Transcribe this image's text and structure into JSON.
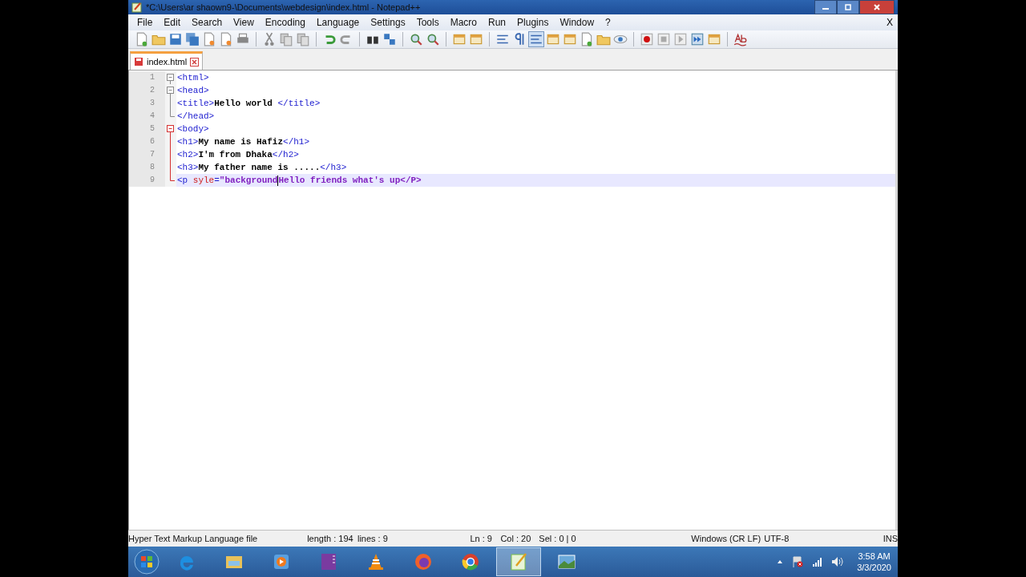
{
  "window": {
    "title": "*C:\\Users\\ar shaown9-\\Documents\\webdesign\\index.html - Notepad++"
  },
  "menu": [
    "File",
    "Edit",
    "Search",
    "View",
    "Encoding",
    "Language",
    "Settings",
    "Tools",
    "Macro",
    "Run",
    "Plugins",
    "Window",
    "?"
  ],
  "menu_close": "X",
  "tabs": [
    {
      "label": "index.html",
      "selected": true,
      "modified": true
    }
  ],
  "editor": {
    "lines": [
      {
        "number": "1",
        "fold": {
          "kind": "minus",
          "active": false
        },
        "current": false,
        "tokens": [
          {
            "kind": "tag",
            "text": "<html>"
          }
        ]
      },
      {
        "number": "2",
        "fold": {
          "kind": "minus",
          "active": false
        },
        "current": false,
        "tokens": [
          {
            "kind": "tag",
            "text": "<head>"
          }
        ]
      },
      {
        "number": "3",
        "fold": {
          "kind": "bar",
          "active": false
        },
        "current": false,
        "tokens": [
          {
            "kind": "tag",
            "text": "<title>"
          },
          {
            "kind": "text",
            "text": "Hello world "
          },
          {
            "kind": "tag",
            "text": "</title>"
          }
        ]
      },
      {
        "number": "4",
        "fold": {
          "kind": "corner",
          "active": false
        },
        "current": false,
        "tokens": [
          {
            "kind": "tag",
            "text": "</head>"
          }
        ]
      },
      {
        "number": "5",
        "fold": {
          "kind": "minus",
          "active": true
        },
        "current": false,
        "tokens": [
          {
            "kind": "tag",
            "text": "<body>"
          }
        ]
      },
      {
        "number": "6",
        "fold": {
          "kind": "bar",
          "active": true
        },
        "current": false,
        "tokens": [
          {
            "kind": "tag",
            "text": "<h1>"
          },
          {
            "kind": "text",
            "text": "My name is Hafiz"
          },
          {
            "kind": "tag",
            "text": "</h1>"
          }
        ]
      },
      {
        "number": "7",
        "fold": {
          "kind": "bar",
          "active": true
        },
        "current": false,
        "tokens": [
          {
            "kind": "tag",
            "text": "<h2>"
          },
          {
            "kind": "text",
            "text": "I'm from Dhaka"
          },
          {
            "kind": "tag",
            "text": "</h2>"
          }
        ]
      },
      {
        "number": "8",
        "fold": {
          "kind": "bar",
          "active": true
        },
        "current": false,
        "tokens": [
          {
            "kind": "tag",
            "text": "<h3>"
          },
          {
            "kind": "text",
            "text": "My father name is ....."
          },
          {
            "kind": "tag",
            "text": "</h3>"
          }
        ]
      },
      {
        "number": "9",
        "fold": {
          "kind": "corner",
          "active": true
        },
        "current": true,
        "tokens": [
          {
            "kind": "tag",
            "text": "<p"
          },
          {
            "kind": "attr",
            "text": " syle"
          },
          {
            "kind": "tag",
            "text": "="
          },
          {
            "kind": "string",
            "text": "\"background"
          },
          {
            "kind": "string",
            "text": "Hello friends what's up</P>",
            "caret": true
          }
        ]
      }
    ]
  },
  "status_bar": {
    "file_type": "Hyper Text Markup Language file",
    "length": "length : 194",
    "lines": "lines : 9",
    "position": "Ln : 9",
    "column": "Col : 20",
    "selection": "Sel : 0 | 0",
    "eol": "Windows (CR LF)",
    "encoding": "UTF-8",
    "mode": "INS"
  },
  "taskbar": {
    "apps": [
      {
        "kind": "ie",
        "active": false
      },
      {
        "kind": "explorer",
        "active": false
      },
      {
        "kind": "media",
        "active": false
      },
      {
        "kind": "onenote",
        "active": false
      },
      {
        "kind": "vlc",
        "active": false
      },
      {
        "kind": "firefox",
        "active": false
      },
      {
        "kind": "chrome",
        "active": false
      },
      {
        "kind": "notepad",
        "active": true
      },
      {
        "kind": "photos",
        "active": false
      }
    ],
    "time": "3:58 AM",
    "date": "3/3/2020"
  }
}
